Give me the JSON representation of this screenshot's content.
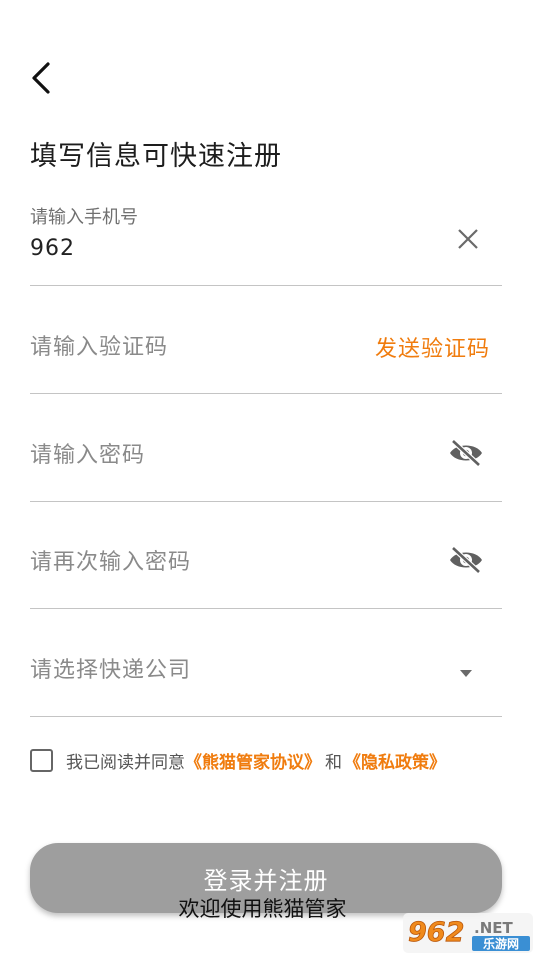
{
  "header": {
    "title": "填写信息可快速注册"
  },
  "form": {
    "phone": {
      "label": "请输入手机号",
      "value": "962"
    },
    "code": {
      "placeholder": "请输入验证码",
      "send_label": "发送验证码"
    },
    "password": {
      "placeholder": "请输入密码"
    },
    "password_confirm": {
      "placeholder": "请再次输入密码"
    },
    "courier": {
      "placeholder": "请选择快递公司"
    }
  },
  "agreement": {
    "prefix": "我已阅读并同意",
    "link1": "《熊猫管家协议》",
    "middle": "和",
    "link2": "《隐私政策》",
    "checked": false
  },
  "login_button": {
    "label": "登录并注册"
  },
  "toast": {
    "text": "欢迎使用熊猫管家"
  },
  "watermark": {
    "number": "962",
    "suffix": ".NET",
    "site": "乐游网"
  },
  "colors": {
    "accent": "#f07c0e",
    "button_disabled": "#9e9e9e",
    "divider": "#c4c4c4",
    "placeholder": "#8a8a8a"
  }
}
